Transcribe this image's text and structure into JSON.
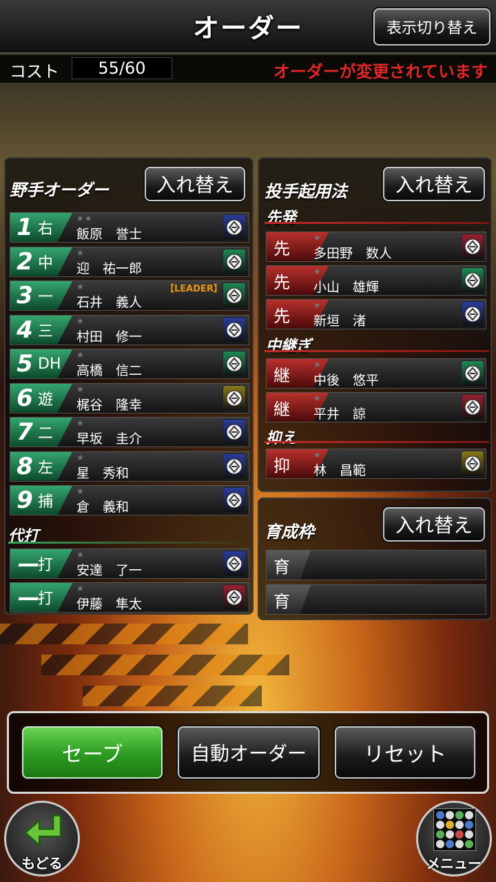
{
  "header": {
    "title": "オーダー",
    "toggle_label": "表示切り替え"
  },
  "cost": {
    "label": "コスト",
    "value": "55/60",
    "notice": "オーダーが変更されています"
  },
  "fielders": {
    "section_title": "野手オーダー",
    "swap_label": "入れ替え",
    "rows": [
      {
        "num": "1",
        "pos": "右",
        "stars": "★★",
        "name": "飯原　誉士",
        "mitt": "blue"
      },
      {
        "num": "2",
        "pos": "中",
        "stars": "★",
        "name": "迎　祐一郎",
        "mitt": "green"
      },
      {
        "num": "3",
        "pos": "一",
        "stars": "★",
        "name": "石井　義人",
        "mitt": "green",
        "badge": "【LEADER】"
      },
      {
        "num": "4",
        "pos": "三",
        "stars": "★",
        "name": "村田　修一",
        "mitt": "blue"
      },
      {
        "num": "5",
        "pos": "DH",
        "stars": "★",
        "name": "高橋　信二",
        "mitt": "green"
      },
      {
        "num": "6",
        "pos": "遊",
        "stars": "★",
        "name": "梶谷　隆幸",
        "mitt": "yellow"
      },
      {
        "num": "7",
        "pos": "二",
        "stars": "★",
        "name": "早坂　圭介",
        "mitt": "blue"
      },
      {
        "num": "8",
        "pos": "左",
        "stars": "★",
        "name": "星　秀和",
        "mitt": "blue"
      },
      {
        "num": "9",
        "pos": "捕",
        "stars": "★",
        "name": "倉　義和",
        "mitt": "blue"
      }
    ],
    "pinch_title": "代打",
    "pinch": [
      {
        "num": "ー",
        "pos": "打",
        "stars": "★",
        "name": "安達　了一",
        "mitt": "blue"
      },
      {
        "num": "ー",
        "pos": "打",
        "stars": "★",
        "name": "伊藤　隼太",
        "mitt": "red"
      }
    ]
  },
  "pitchers": {
    "section_title": "投手起用法",
    "swap_label": "入れ替え",
    "starter_title": "先発",
    "starters": [
      {
        "role": "先",
        "stars": "★",
        "name": "多田野　数人",
        "mitt": "red"
      },
      {
        "role": "先",
        "stars": "★",
        "name": "小山　雄輝",
        "mitt": "green"
      },
      {
        "role": "先",
        "stars": "★",
        "name": "新垣　渚",
        "mitt": "blue"
      }
    ],
    "relief_title": "中継ぎ",
    "relievers": [
      {
        "role": "継",
        "stars": "★",
        "name": "中後　悠平",
        "mitt": "green"
      },
      {
        "role": "継",
        "stars": "★",
        "name": "平井　諒",
        "mitt": "red"
      }
    ],
    "closer_title": "抑え",
    "closers": [
      {
        "role": "抑",
        "stars": "★",
        "name": "林　昌範",
        "mitt": "yellow"
      }
    ]
  },
  "training": {
    "section_title": "育成枠",
    "swap_label": "入れ替え",
    "slots": [
      {
        "role": "育"
      },
      {
        "role": "育"
      }
    ]
  },
  "actions": {
    "save": "セーブ",
    "auto": "自動オーダー",
    "reset": "リセット"
  },
  "nav": {
    "back": "もどる",
    "menu": "メニュー"
  },
  "colors": {
    "mitt_blue": "#2b3c9e",
    "mitt_green": "#1f8a55",
    "mitt_yellow": "#8a7a18",
    "mitt_red": "#9a2030",
    "save_green": "#36b02c",
    "notice_red": "#e0262a"
  }
}
